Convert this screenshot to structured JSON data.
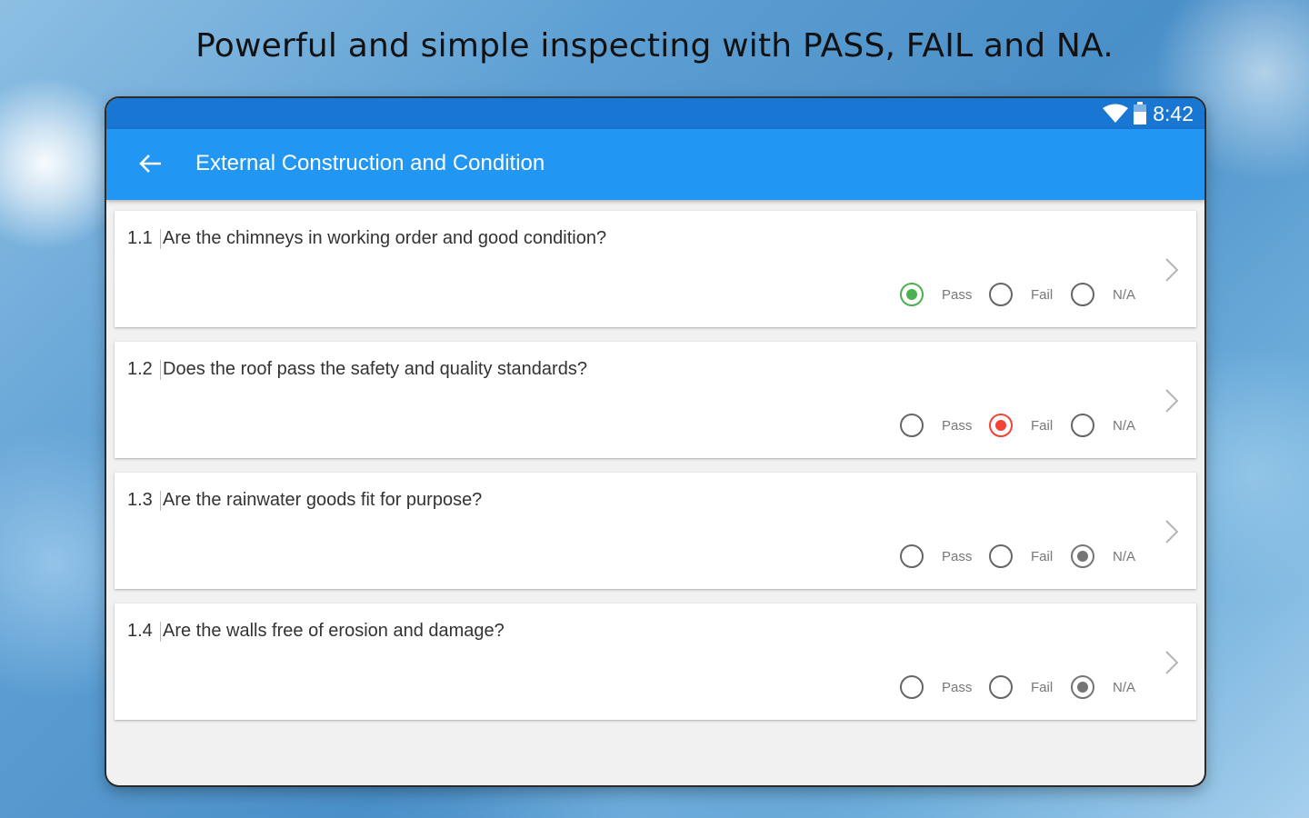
{
  "headline": "Powerful and simple inspecting with PASS, FAIL and NA.",
  "status_bar": {
    "time": "8:42"
  },
  "app_bar": {
    "title": "External Construction and Condition"
  },
  "colors": {
    "app_bar": "#2196f3",
    "status_bar": "#1976d2",
    "pass_selected": "#4caf50",
    "fail_selected": "#f44336",
    "na_selected": "#757575"
  },
  "questions": [
    {
      "number": "1.1",
      "text": "Are the chimneys in working order and good condition?",
      "selected": "pass"
    },
    {
      "number": "1.2",
      "text": "Does the roof pass the safety and quality standards?",
      "selected": "fail"
    },
    {
      "number": "1.3",
      "text": "Are the rainwater goods fit for purpose?",
      "selected": "na"
    },
    {
      "number": "1.4",
      "text": "Are the walls free of erosion and damage?",
      "selected": "na"
    }
  ],
  "option_labels": {
    "pass": "Pass",
    "fail": "Fail",
    "na": "N/A"
  }
}
